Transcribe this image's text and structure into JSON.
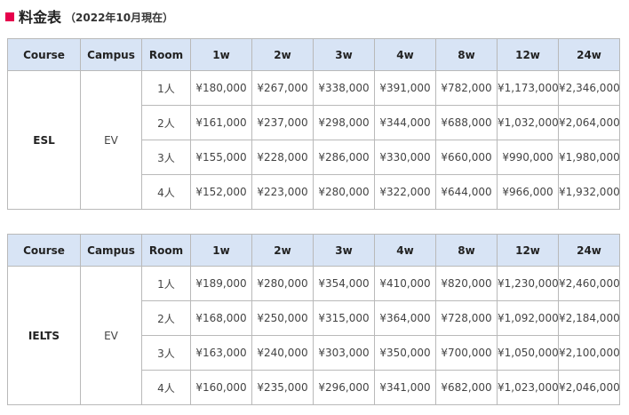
{
  "heading": {
    "title": "料金表",
    "note": "（2022年10月現在）",
    "accent": "#e6004c"
  },
  "header_color": "#d8e4f5",
  "columns": [
    "Course",
    "Campus",
    "Room",
    "1w",
    "2w",
    "3w",
    "4w",
    "8w",
    "12w",
    "24w"
  ],
  "tables": [
    {
      "course": "ESL",
      "campus": "EV",
      "rows": [
        {
          "room": "1人",
          "prices": [
            "¥180,000",
            "¥267,000",
            "¥338,000",
            "¥391,000",
            "¥782,000",
            "¥1,173,000",
            "¥2,346,000"
          ]
        },
        {
          "room": "2人",
          "prices": [
            "¥161,000",
            "¥237,000",
            "¥298,000",
            "¥344,000",
            "¥688,000",
            "¥1,032,000",
            "¥2,064,000"
          ]
        },
        {
          "room": "3人",
          "prices": [
            "¥155,000",
            "¥228,000",
            "¥286,000",
            "¥330,000",
            "¥660,000",
            "¥990,000",
            "¥1,980,000"
          ]
        },
        {
          "room": "4人",
          "prices": [
            "¥152,000",
            "¥223,000",
            "¥280,000",
            "¥322,000",
            "¥644,000",
            "¥966,000",
            "¥1,932,000"
          ]
        }
      ]
    },
    {
      "course": "IELTS",
      "campus": "EV",
      "rows": [
        {
          "room": "1人",
          "prices": [
            "¥189,000",
            "¥280,000",
            "¥354,000",
            "¥410,000",
            "¥820,000",
            "¥1,230,000",
            "¥2,460,000"
          ]
        },
        {
          "room": "2人",
          "prices": [
            "¥168,000",
            "¥250,000",
            "¥315,000",
            "¥364,000",
            "¥728,000",
            "¥1,092,000",
            "¥2,184,000"
          ]
        },
        {
          "room": "3人",
          "prices": [
            "¥163,000",
            "¥240,000",
            "¥303,000",
            "¥350,000",
            "¥700,000",
            "¥1,050,000",
            "¥2,100,000"
          ]
        },
        {
          "room": "4人",
          "prices": [
            "¥160,000",
            "¥235,000",
            "¥296,000",
            "¥341,000",
            "¥682,000",
            "¥1,023,000",
            "¥2,046,000"
          ]
        }
      ]
    }
  ]
}
